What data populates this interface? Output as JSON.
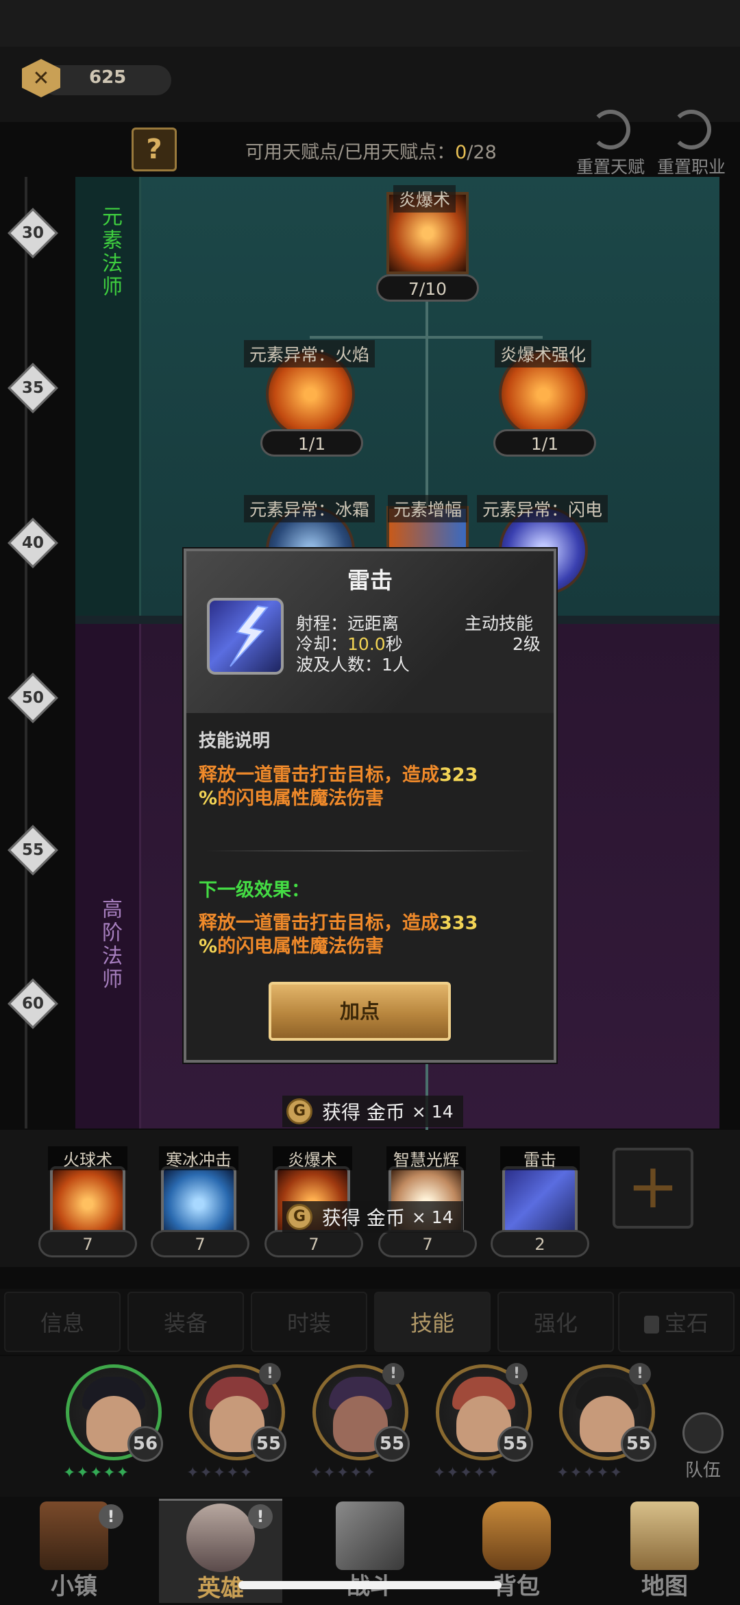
{
  "currency": {
    "value": "625"
  },
  "header": {
    "help_label": "?",
    "points_label": "可用天赋点/已用天赋点：",
    "points_available": "0",
    "points_total": "/28",
    "reset_talent": "重置天赋",
    "reset_class": "重置职业"
  },
  "classes": {
    "basic": "元素法师",
    "advanced": "高阶法师"
  },
  "levels": [
    "30",
    "35",
    "40",
    "50",
    "55",
    "60"
  ],
  "tree": {
    "root": {
      "name": "炎爆术",
      "count": "7/10"
    },
    "fire_anomaly": {
      "name": "元素异常：火焰",
      "count": "1/1"
    },
    "fireball_boost": {
      "name": "炎爆术强化",
      "count": "1/1"
    },
    "ice_anomaly": {
      "name": "元素异常：冰霜"
    },
    "element_amp": {
      "name": "元素增幅"
    },
    "lightning_anomaly": {
      "name": "元素异常：闪电"
    }
  },
  "popup": {
    "title": "雷击",
    "range_label": "射程：远距离",
    "cooldown_label": "冷却：",
    "cooldown_value": "10.0",
    "cooldown_unit": "秒",
    "targets": "波及人数：1人",
    "skill_type": "主动技能",
    "skill_level": "2级",
    "desc_title": "技能说明",
    "desc_line1_prefix": "释放一道雷击打击目标，造成",
    "desc_value": "323",
    "desc_line2_pct": "%",
    "desc_line2_rest": "的闪电属性魔法伤害",
    "next_title": "下一级效果：",
    "next_line1_prefix": "释放一道雷击打击目标，造成",
    "next_value": "333",
    "next_line2_pct": "%",
    "next_line2_rest": "的闪电属性魔法伤害",
    "add_button": "加点"
  },
  "toasts": [
    {
      "coin": "G",
      "text": "获得 金币",
      "mult": "× 14"
    },
    {
      "coin": "G",
      "text": "获得 金币",
      "mult": "× 14"
    }
  ],
  "skill_bar": [
    {
      "name": "火球术",
      "count": "7"
    },
    {
      "name": "寒冰冲击",
      "count": "7"
    },
    {
      "name": "炎爆术",
      "count": "7"
    },
    {
      "name": "智慧光辉",
      "count": "7"
    },
    {
      "name": "雷击",
      "count": "2"
    }
  ],
  "plus_label": "+",
  "tabs": [
    "信息",
    "装备",
    "时装",
    "技能",
    "强化",
    "宝石"
  ],
  "heroes": [
    {
      "level": "56",
      "stars": "✦✦✦✦✦"
    },
    {
      "level": "55",
      "stars": "✦✦✦✦✦"
    },
    {
      "level": "55",
      "stars": "✦✦✦✦✦"
    },
    {
      "level": "55",
      "stars": "✦✦✦✦✦"
    },
    {
      "level": "55",
      "stars": "✦✦✦✦✦"
    }
  ],
  "team_label": "队伍",
  "nav": [
    "小镇",
    "英雄",
    "战斗",
    "背包",
    "地图"
  ],
  "bang": "!"
}
